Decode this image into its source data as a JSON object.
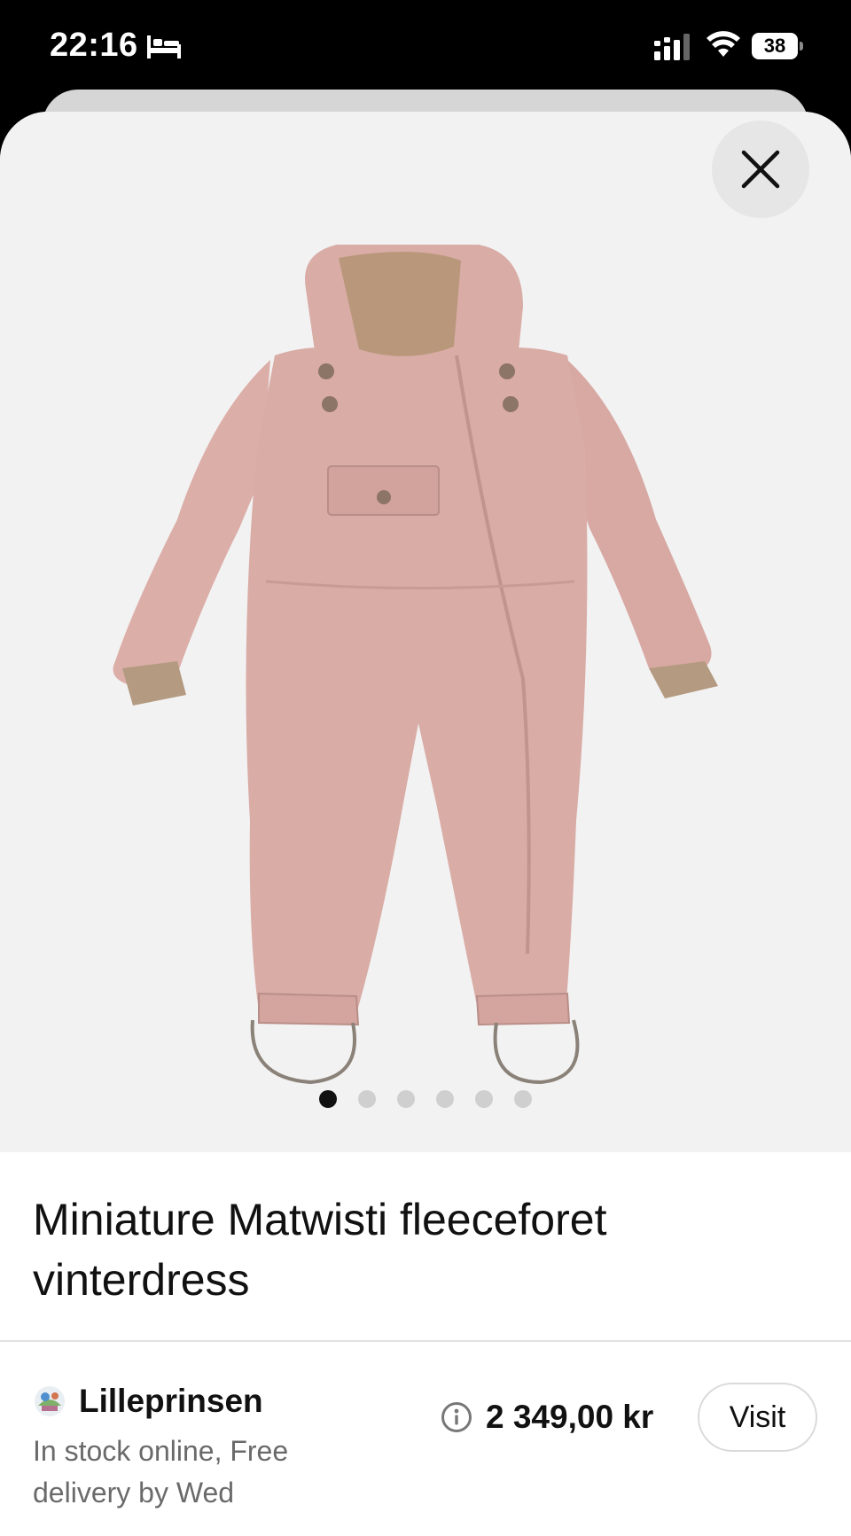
{
  "status_bar": {
    "time": "22:16",
    "battery_level": "38",
    "icons": [
      "bed-icon",
      "cellular-signal-icon",
      "wifi-icon",
      "battery-icon"
    ]
  },
  "product": {
    "title": "Miniature Matwisti fleeceforet vinterdress",
    "image_description_icon": "pink-winter-snowsuit-image",
    "gallery": {
      "total_images": 6,
      "active_index": 0
    }
  },
  "offer": {
    "merchant_name": "Lilleprinsen",
    "stock_text": "In stock online, Free delivery by Wed",
    "price": "2 349,00 kr",
    "visit_label": "Visit"
  },
  "colors": {
    "background_image": "#f2f2f2",
    "suit_pink": "#d9aca6",
    "text_primary": "#111111",
    "text_secondary": "#6a6a6a"
  }
}
